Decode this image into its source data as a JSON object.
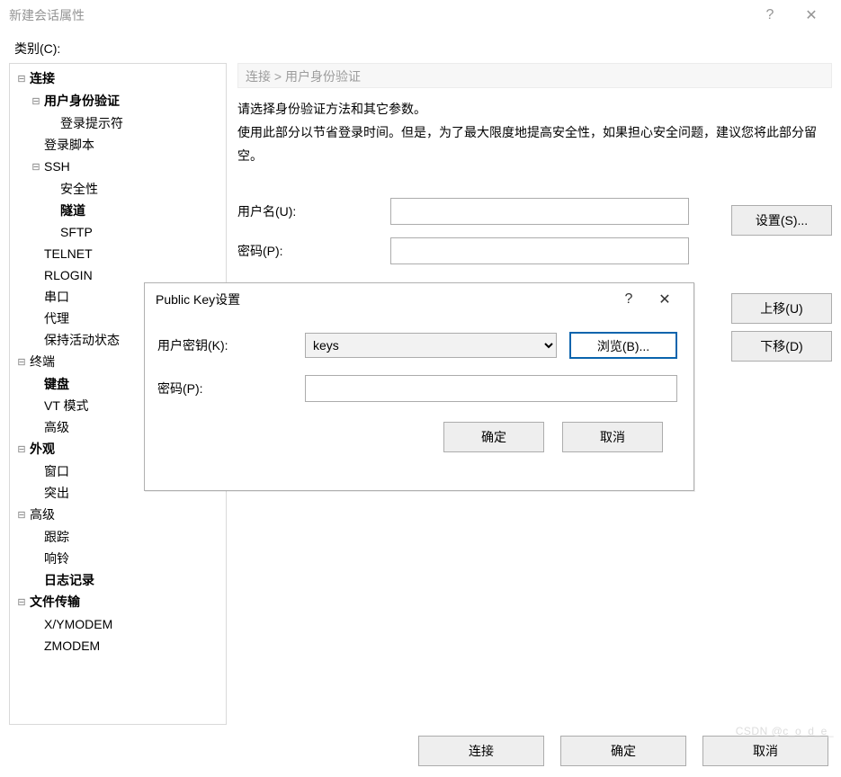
{
  "window": {
    "title": "新建会话属性",
    "help": "?",
    "close": "✕"
  },
  "category_label": "类别(C):",
  "tree": [
    {
      "level": 1,
      "label": "连接",
      "expander": "⊟",
      "bold": true
    },
    {
      "level": 2,
      "label": "用户身份验证",
      "expander": "⊟",
      "bold": true
    },
    {
      "level": 3,
      "label": "登录提示符",
      "expander": ""
    },
    {
      "level": 2,
      "label": "登录脚本",
      "expander": ""
    },
    {
      "level": 2,
      "label": "SSH",
      "expander": "⊟"
    },
    {
      "level": 3,
      "label": "安全性",
      "expander": ""
    },
    {
      "level": 3,
      "label": "隧道",
      "expander": "",
      "bold": true
    },
    {
      "level": 3,
      "label": "SFTP",
      "expander": ""
    },
    {
      "level": 2,
      "label": "TELNET",
      "expander": ""
    },
    {
      "level": 2,
      "label": "RLOGIN",
      "expander": ""
    },
    {
      "level": 2,
      "label": "串口",
      "expander": ""
    },
    {
      "level": 2,
      "label": "代理",
      "expander": ""
    },
    {
      "level": 2,
      "label": "保持活动状态",
      "expander": ""
    },
    {
      "level": 1,
      "label": "终端",
      "expander": "⊟"
    },
    {
      "level": 2,
      "label": "键盘",
      "expander": "",
      "bold": true
    },
    {
      "level": 2,
      "label": "VT 模式",
      "expander": ""
    },
    {
      "level": 2,
      "label": "高级",
      "expander": ""
    },
    {
      "level": 1,
      "label": "外观",
      "expander": "⊟",
      "bold": true
    },
    {
      "level": 2,
      "label": "窗口",
      "expander": ""
    },
    {
      "level": 2,
      "label": "突出",
      "expander": ""
    },
    {
      "level": 1,
      "label": "高级",
      "expander": "⊟"
    },
    {
      "level": 2,
      "label": "跟踪",
      "expander": ""
    },
    {
      "level": 2,
      "label": "响铃",
      "expander": ""
    },
    {
      "level": 2,
      "label": "日志记录",
      "expander": "",
      "bold": true
    },
    {
      "level": 1,
      "label": "文件传输",
      "expander": "⊟",
      "bold": true
    },
    {
      "level": 2,
      "label": "X/YMODEM",
      "expander": ""
    },
    {
      "level": 2,
      "label": "ZMODEM",
      "expander": ""
    }
  ],
  "breadcrumb": "连接  >  用户身份验证",
  "intro": {
    "line1": "请选择身份验证方法和其它参数。",
    "line2": "使用此部分以节省登录时间。但是，为了最大限度地提高安全性，如果担心安全问题，建议您将此部分留空。"
  },
  "form": {
    "username_label": "用户名(U):",
    "username_value": "",
    "password_label": "密码(P):",
    "password_value": ""
  },
  "side_buttons": {
    "setup": "设置(S)...",
    "move_up": "上移(U)",
    "move_down": "下移(D)"
  },
  "footer": {
    "connect": "连接",
    "ok": "确定",
    "cancel": "取消"
  },
  "modal": {
    "title": "Public Key设置",
    "help": "?",
    "close": "✕",
    "user_key_label": "用户密钥(K):",
    "user_key_value": "keys",
    "browse": "浏览(B)...",
    "password_label": "密码(P):",
    "password_value": "",
    "ok": "确定",
    "cancel": "取消"
  },
  "watermark": "CSDN @c_o_d_e_"
}
